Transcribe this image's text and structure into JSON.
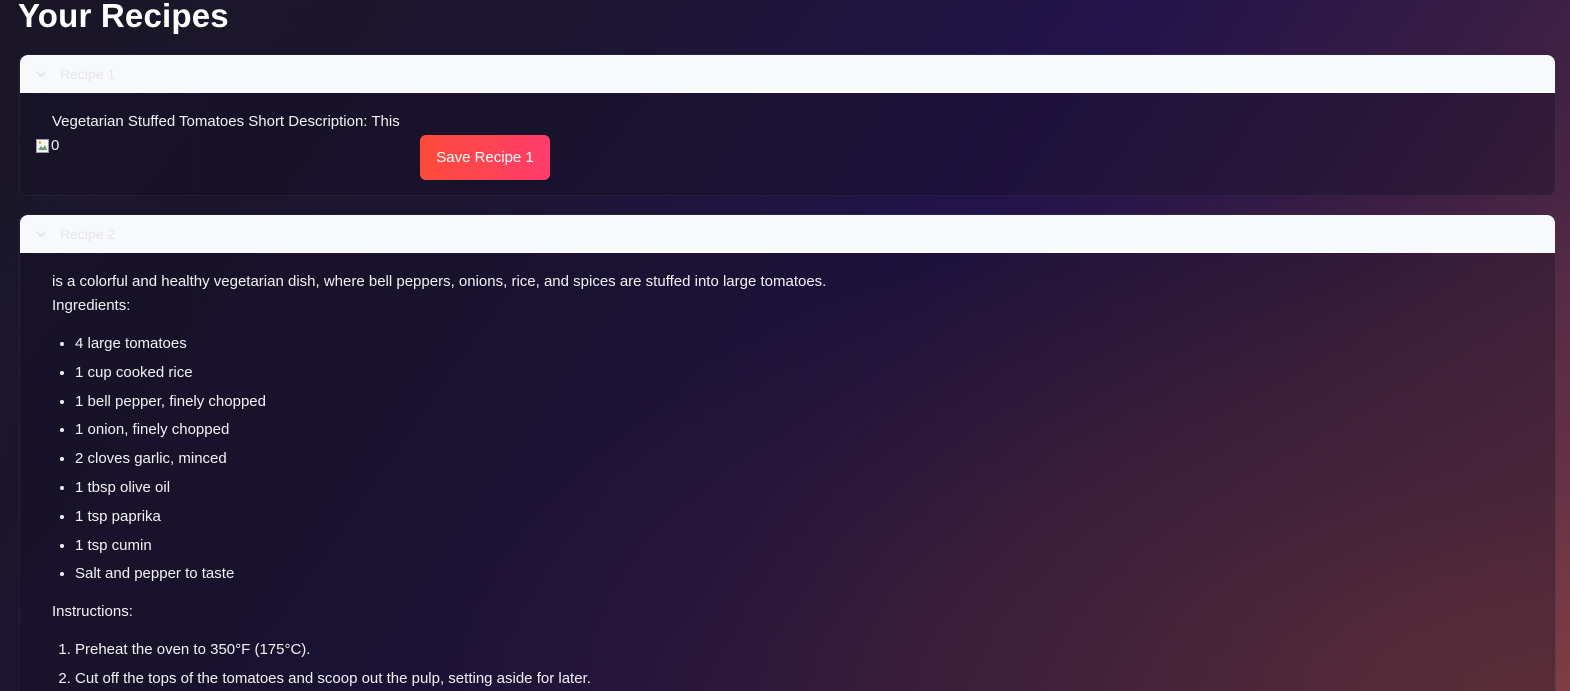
{
  "page": {
    "title": "Your Recipes"
  },
  "colors": {
    "accent_button_start": "#ff4b3a",
    "accent_button_end": "#ff3d6b",
    "expander_header_bg": "#f8f9fb"
  },
  "recipe1": {
    "label": "Recipe 1",
    "text": "Vegetarian Stuffed Tomatoes Short Description: This",
    "image_alt": "0",
    "save_label": "Save Recipe 1",
    "icon": "chevron-down-icon"
  },
  "recipe2": {
    "label": "Recipe 2",
    "description": "is a colorful and healthy vegetarian dish, where bell peppers, onions, rice, and spices are stuffed into large tomatoes.",
    "ingredients_heading": "Ingredients:",
    "ingredients": [
      "4 large tomatoes",
      "1 cup cooked rice",
      "1 bell pepper, finely chopped",
      "1 onion, finely chopped",
      "2 cloves garlic, minced",
      "1 tbsp olive oil",
      "1 tsp paprika",
      "1 tsp cumin",
      "Salt and pepper to taste"
    ],
    "instructions_heading": "Instructions:",
    "instructions": [
      "Preheat the oven to 350°F (175°C).",
      "Cut off the tops of the tomatoes and scoop out the pulp, setting aside for later."
    ],
    "icon": "chevron-down-icon"
  }
}
